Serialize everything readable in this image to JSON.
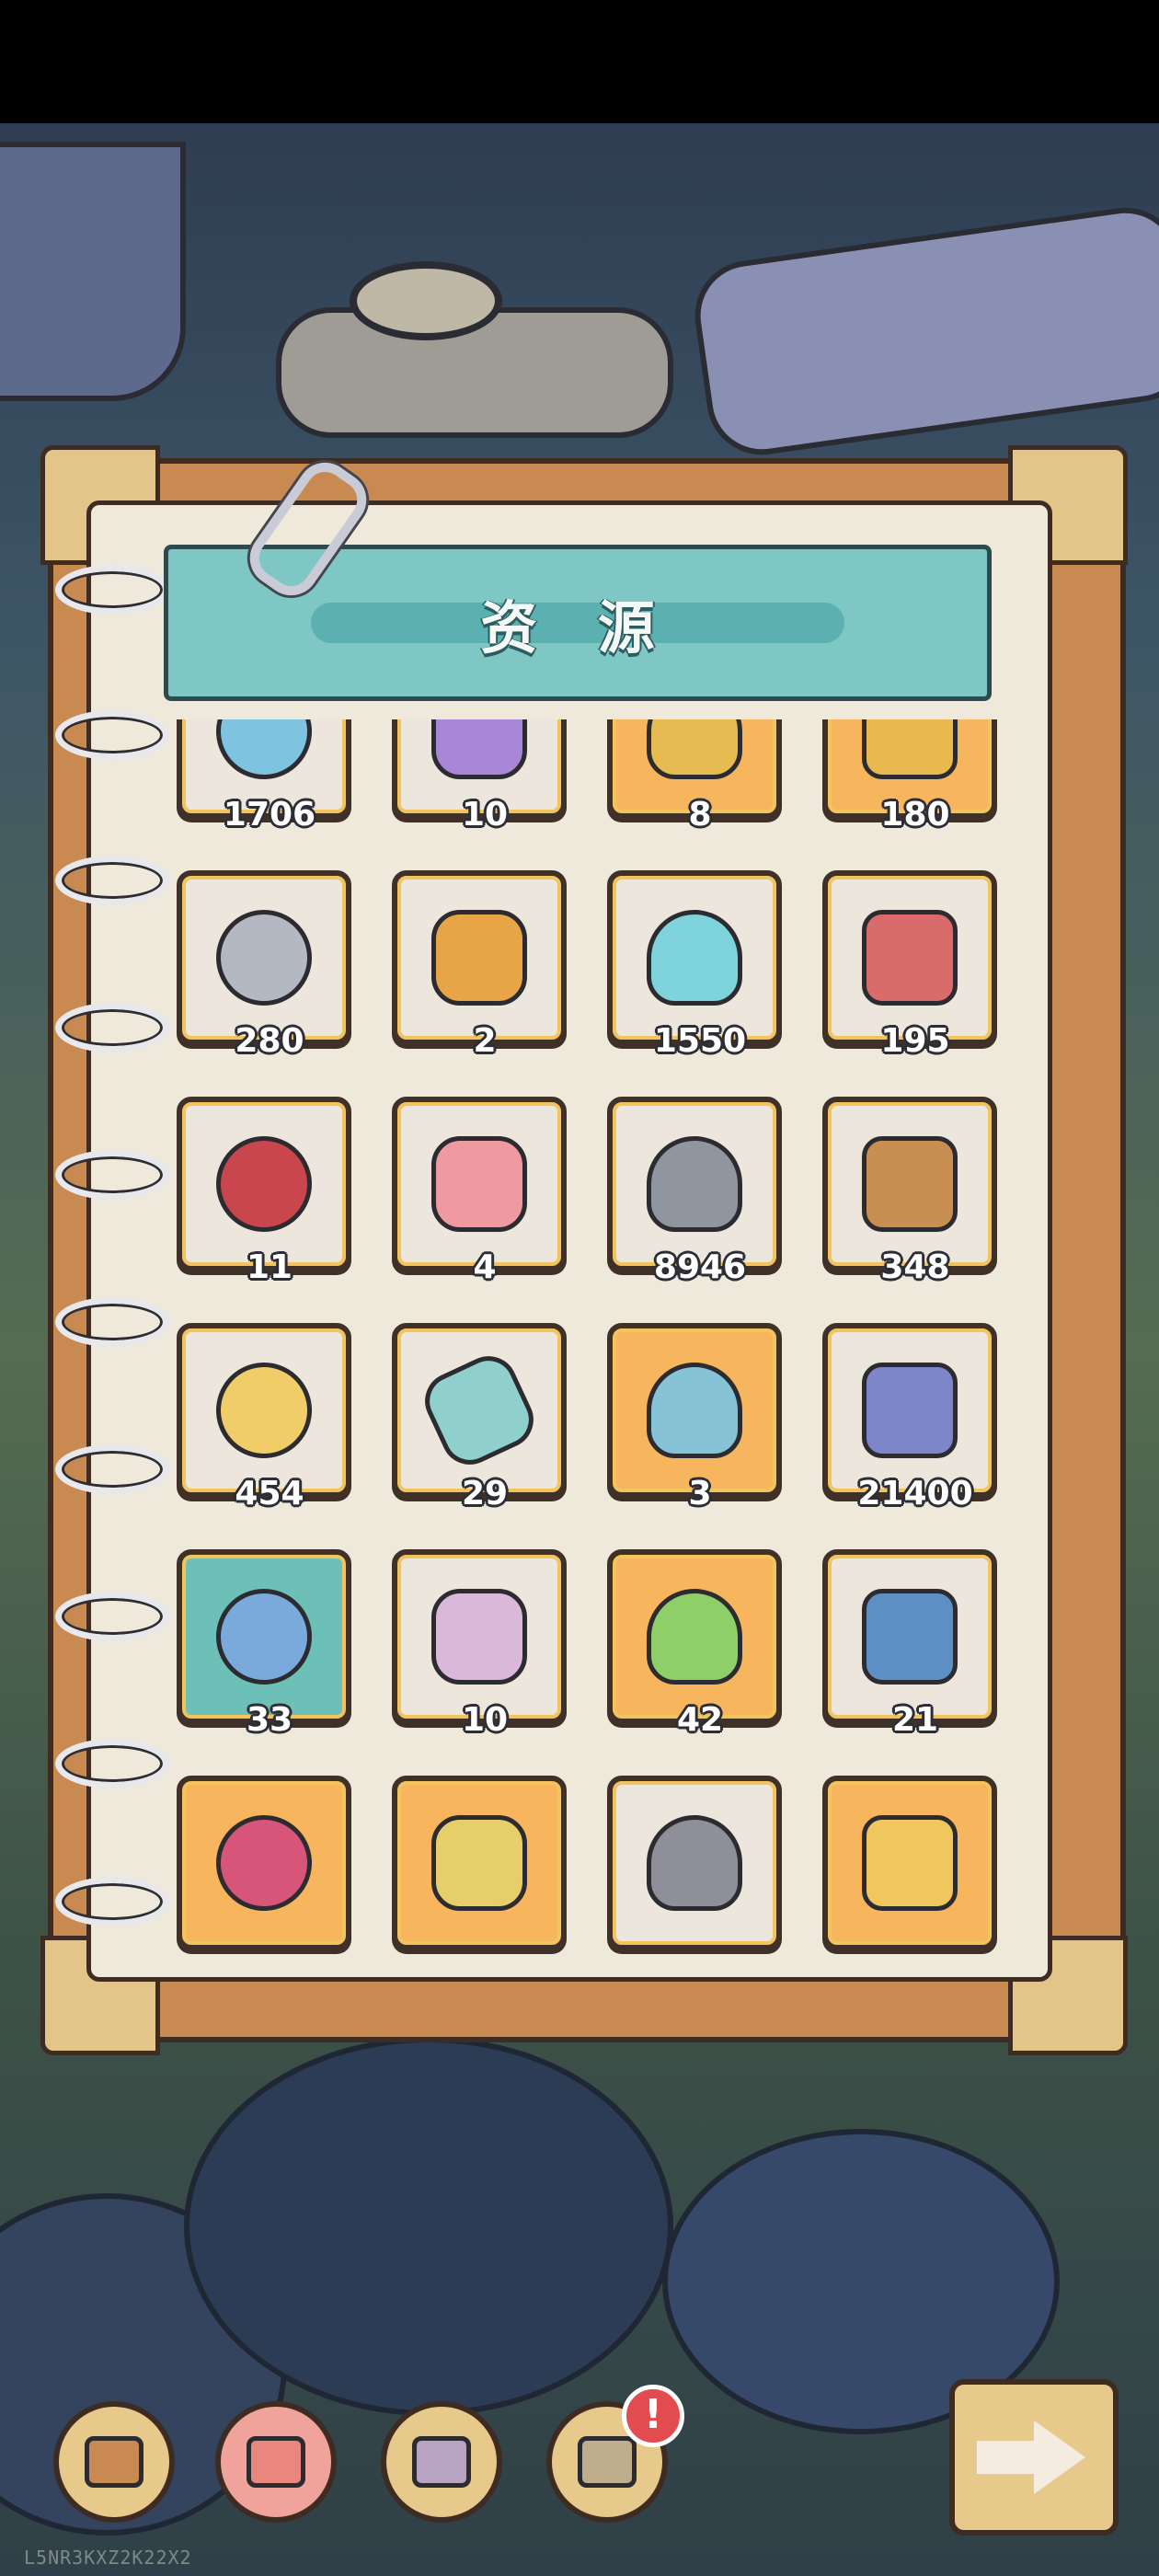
{
  "header": {
    "title": "资 源"
  },
  "items": [
    {
      "qty": "1706",
      "icon": "ticket-icon",
      "color": "#7ec3df",
      "bg": "plain"
    },
    {
      "qty": "10",
      "icon": "purple-star-icon",
      "color": "#a987d8",
      "bg": "plain"
    },
    {
      "qty": "8",
      "icon": "clover-coin-icon",
      "color": "#e6bb52",
      "bg": "gold"
    },
    {
      "qty": "180",
      "icon": "gold-medal-icon",
      "color": "#e9b84e",
      "bg": "gold"
    },
    {
      "qty": "280",
      "icon": "silver-coin-icon",
      "color": "#b4b8c2",
      "bg": "plain"
    },
    {
      "qty": "2",
      "icon": "award-ribbon-icon",
      "color": "#e7a548",
      "bg": "plain"
    },
    {
      "qty": "1550",
      "icon": "crystal-badge-icon",
      "color": "#7fd3dd",
      "bg": "plain"
    },
    {
      "qty": "195",
      "icon": "boxing-glove-icon",
      "color": "#d96b6b",
      "bg": "plain"
    },
    {
      "qty": "11",
      "icon": "gamepad-icon",
      "color": "#c9464c",
      "bg": "plain"
    },
    {
      "qty": "4",
      "icon": "brain-icon",
      "color": "#ee9aa0",
      "bg": "plain"
    },
    {
      "qty": "8946",
      "icon": "stone-icon",
      "color": "#8f96a0",
      "bg": "plain"
    },
    {
      "qty": "348",
      "icon": "wood-logs-icon",
      "color": "#c98f52",
      "bg": "plain"
    },
    {
      "qty": "454",
      "icon": "tube-icon",
      "color": "#f1cd6a",
      "bg": "plain"
    },
    {
      "qty": "29",
      "icon": "map-scroll-icon",
      "color": "#8fd0cd",
      "bg": "plain"
    },
    {
      "qty": "3",
      "icon": "blue-crystal-icon",
      "color": "#86c3d7",
      "bg": "gold"
    },
    {
      "qty": "21400",
      "icon": "capsule-icon",
      "color": "#7c86c9",
      "bg": "plain"
    },
    {
      "qty": "33",
      "icon": "bubble-orb-icon",
      "color": "#7aa9dc",
      "bg": "teal"
    },
    {
      "qty": "10",
      "icon": "potion-bottle-icon",
      "color": "#d9b8d9",
      "bg": "plain"
    },
    {
      "qty": "42",
      "icon": "molecule-icon",
      "color": "#8fcf6a",
      "bg": "gold"
    },
    {
      "qty": "21",
      "icon": "armor-orb-icon",
      "color": "#5e8fc4",
      "bg": "plain"
    },
    {
      "qty": "",
      "icon": "pink-ticket-icon",
      "color": "#d8557a",
      "bg": "gold"
    },
    {
      "qty": "",
      "icon": "yin-yang-coin-icon",
      "color": "#e6cf6b",
      "bg": "gold"
    },
    {
      "qty": "",
      "icon": "koi-fish-icon",
      "color": "#8e8f98",
      "bg": "plain"
    },
    {
      "qty": "",
      "icon": "flower-coin-icon",
      "color": "#f0c65e",
      "bg": "gold"
    }
  ],
  "nav": [
    {
      "name": "backpack-button",
      "icon": "backpack-icon",
      "color": "#c98a52"
    },
    {
      "name": "herb-button",
      "icon": "herb-branch-icon",
      "color": "#e9867e"
    },
    {
      "name": "pet-button",
      "icon": "pet-face-icon",
      "color": "#b7a3c2"
    },
    {
      "name": "camera-button",
      "icon": "camera-icon",
      "color": "#bfae8e"
    }
  ],
  "badge": {
    "text": "!"
  },
  "watermark": {
    "text": "L5NR3KXZ2K22X2"
  }
}
